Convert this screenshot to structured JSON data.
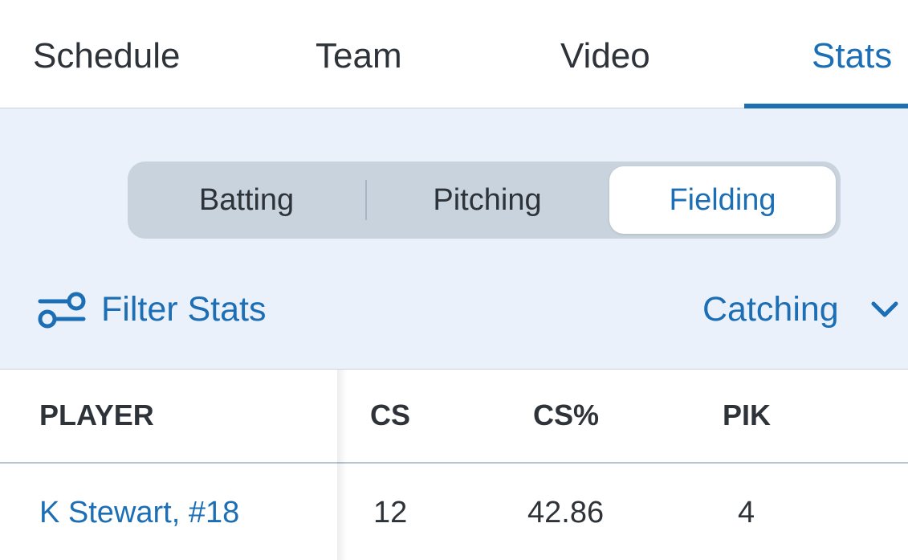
{
  "top_tabs": {
    "schedule": "Schedule",
    "team": "Team",
    "video": "Video",
    "stats": "Stats"
  },
  "segments": {
    "batting": "Batting",
    "pitching": "Pitching",
    "fielding": "Fielding",
    "selected": "Fielding"
  },
  "filter": {
    "label": "Filter Stats",
    "icon": "sliders-icon"
  },
  "category": {
    "selected": "Catching",
    "icon": "chevron-down-icon"
  },
  "table": {
    "columns": [
      "PLAYER",
      "CS",
      "CS%",
      "PIK"
    ],
    "rows": [
      {
        "player": "K Stewart, #18",
        "cs": "12",
        "cs_pct": "42.86",
        "pik": "4"
      }
    ]
  },
  "colors": {
    "accent": "#1c6eb5",
    "text": "#2d3338",
    "panel_bg": "#eaf1fa",
    "segment_bg": "#c8d3dd"
  }
}
